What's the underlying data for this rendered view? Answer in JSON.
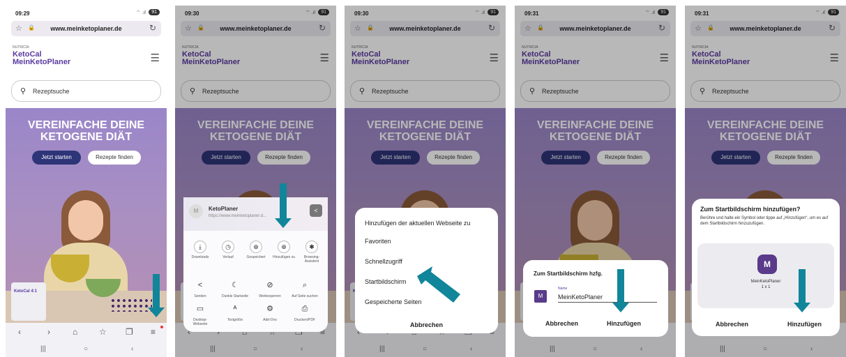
{
  "browser": {
    "url": "www.meinketoplaner.de",
    "star_icon": "☆",
    "lock_icon": "🔒",
    "reload_icon": "↻"
  },
  "site": {
    "brand_small": "NUTRICIA",
    "logo_line1": "KetoCal",
    "logo_line2": "MeinKetoPlaner",
    "search_placeholder": "Rezeptsuche",
    "hero_title_line1": "VEREINFACHE DEINE",
    "hero_title_line2": "KETOGENE DIÄT",
    "btn_start": "Jetzt starten",
    "btn_recipes": "Rezepte finden",
    "can_label": "KetoCal 4:1"
  },
  "phones": [
    {
      "time": "09:29",
      "battery": "91"
    },
    {
      "time": "09:30",
      "battery": "91"
    },
    {
      "time": "09:30",
      "battery": "91"
    },
    {
      "time": "09:31",
      "battery": "91"
    },
    {
      "time": "09:31",
      "battery": "91"
    }
  ],
  "share_menu": {
    "site_name": "KetoPlaner",
    "site_url": "https://www.meinketoplaner.d...",
    "avatar": "M",
    "row1": [
      "Downloads",
      "Verlauf",
      "Gespeichert",
      "Hinzufügen zu",
      "Browsing-Assistent"
    ],
    "row2": [
      "Senden",
      "Dunkle Startseite",
      "Werbesperren",
      "Auf Seite suchen"
    ],
    "row3": [
      "Desktop-Webseite",
      "Textgröße",
      "Add-Ons",
      "Drucken/PDF"
    ]
  },
  "add_menu": {
    "title": "Hinzufügen der aktuellen Webseite zu",
    "items": [
      "Favoriten",
      "Schnellzugriff",
      "Startbildschirm",
      "Gespeicherte Seiten"
    ],
    "cancel": "Abbrechen"
  },
  "home_dialog": {
    "title": "Zum Startbildschirm hzfg.",
    "icon_letter": "M",
    "name_label": "Name",
    "name_value": "MeinKetoPlaner",
    "cancel": "Abbrechen",
    "add": "Hinzufügen"
  },
  "widget_dialog": {
    "title": "Zum Startbildschirm hinzufügen?",
    "description": "Berühre und halte ein Symbol oder tippe auf „Hinzufügen“, um es auf dem Startbildschirm hinzuzufügen.",
    "app_letter": "M",
    "app_name": "MeinKetoPlaner",
    "app_size": "1 x 1",
    "cancel": "Abbrechen",
    "add": "Hinzufügen"
  },
  "colors": {
    "accent": "#11859a",
    "brand": "#5a3aa0",
    "hero_bg": "#9a86c9",
    "button_dark": "#2e3478"
  }
}
